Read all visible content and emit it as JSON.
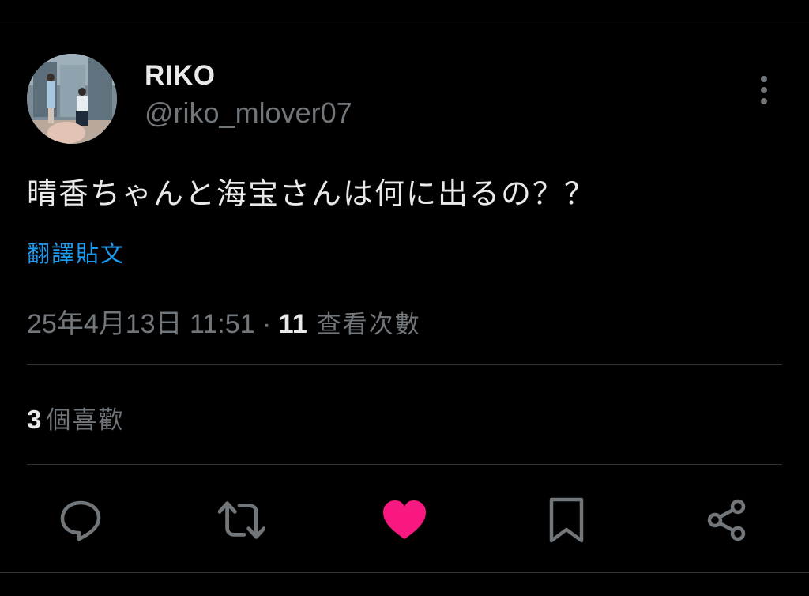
{
  "tweet": {
    "author": {
      "display_name": "RIKO",
      "handle": "@riko_mlover07"
    },
    "text": "晴香ちゃんと海宝さんは何に出るの？？",
    "translate_label": "翻譯貼文",
    "timestamp": "25年4月13日 11:51",
    "separator": " · ",
    "views_count": "11",
    "views_label": " 查看次數",
    "likes_count": "3",
    "likes_label": "個喜歡"
  },
  "actions": [
    {
      "icon": "reply-icon",
      "color": "#71767b"
    },
    {
      "icon": "retweet-icon",
      "color": "#71767b"
    },
    {
      "icon": "heart-filled-icon",
      "color": "#f91880",
      "active": true
    },
    {
      "icon": "bookmark-icon",
      "color": "#71767b"
    },
    {
      "icon": "share-icon",
      "color": "#71767b"
    }
  ],
  "colors": {
    "background": "#000000",
    "text_primary": "#e7e9ea",
    "text_secondary": "#71767b",
    "link": "#1d9bf0",
    "like_active": "#f91880",
    "divider": "#2f3336"
  }
}
